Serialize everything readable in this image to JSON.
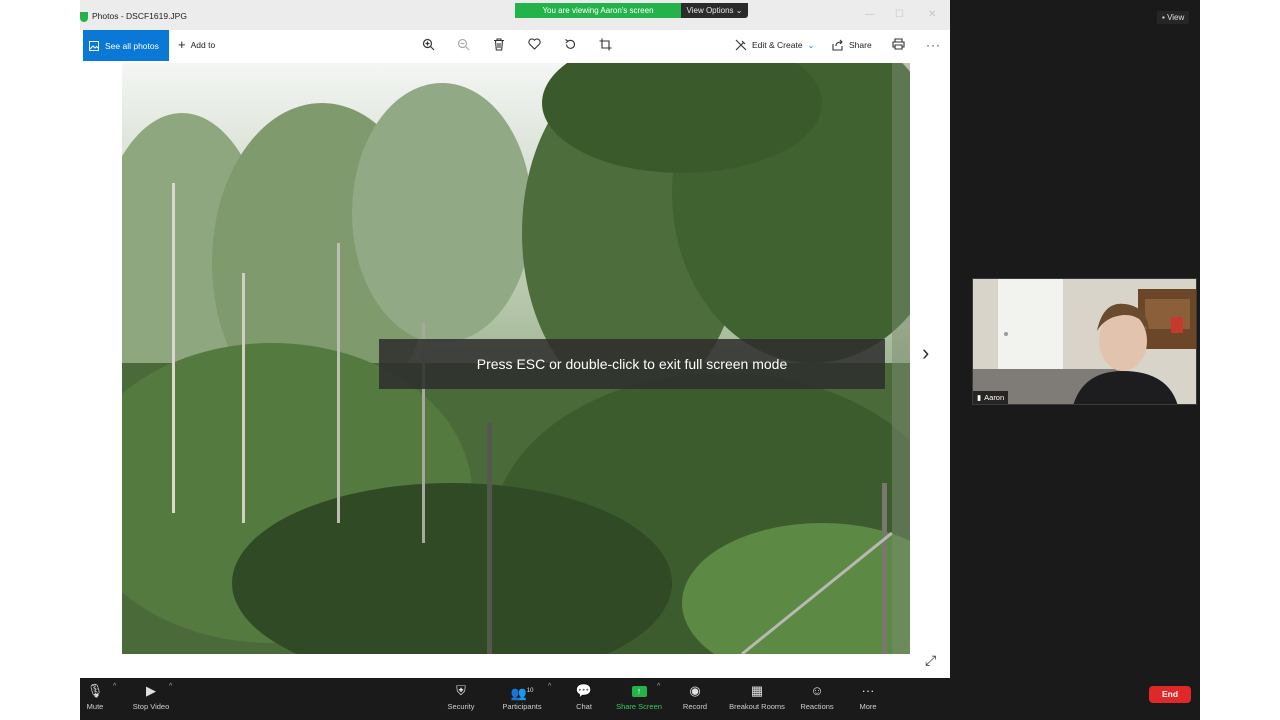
{
  "share_banner": {
    "message": "You are viewing Aaron's screen",
    "options_label": "View Options ⌄"
  },
  "photos": {
    "window_title": "Photos - DSCF1619.JPG",
    "see_all": "See all photos",
    "add_to": "Add to",
    "edit_create": "Edit & Create",
    "share": "Share",
    "esc_message": "Press ESC or double-click to exit full screen mode",
    "icons": [
      "zoom-in-icon",
      "zoom-out-icon",
      "delete-icon",
      "heart-icon",
      "rotate-icon",
      "crop-icon",
      "edit-icon",
      "share-icon",
      "print-icon",
      "more-icon",
      "next-icon",
      "expand-icon"
    ]
  },
  "zoom": {
    "view_label": "View",
    "participant_name": "Aaron",
    "participants_count": "10",
    "controls": {
      "mute": "Mute",
      "stop_video": "Stop Video",
      "security": "Security",
      "participants": "Participants",
      "chat": "Chat",
      "share_screen": "Share Screen",
      "record": "Record",
      "breakout_rooms": "Breakout Rooms",
      "reactions": "Reactions",
      "more": "More",
      "end": "End"
    }
  },
  "colors": {
    "accent_blue": "#0a78d6",
    "zoom_green": "#24b24a",
    "end_red": "#e02828"
  }
}
